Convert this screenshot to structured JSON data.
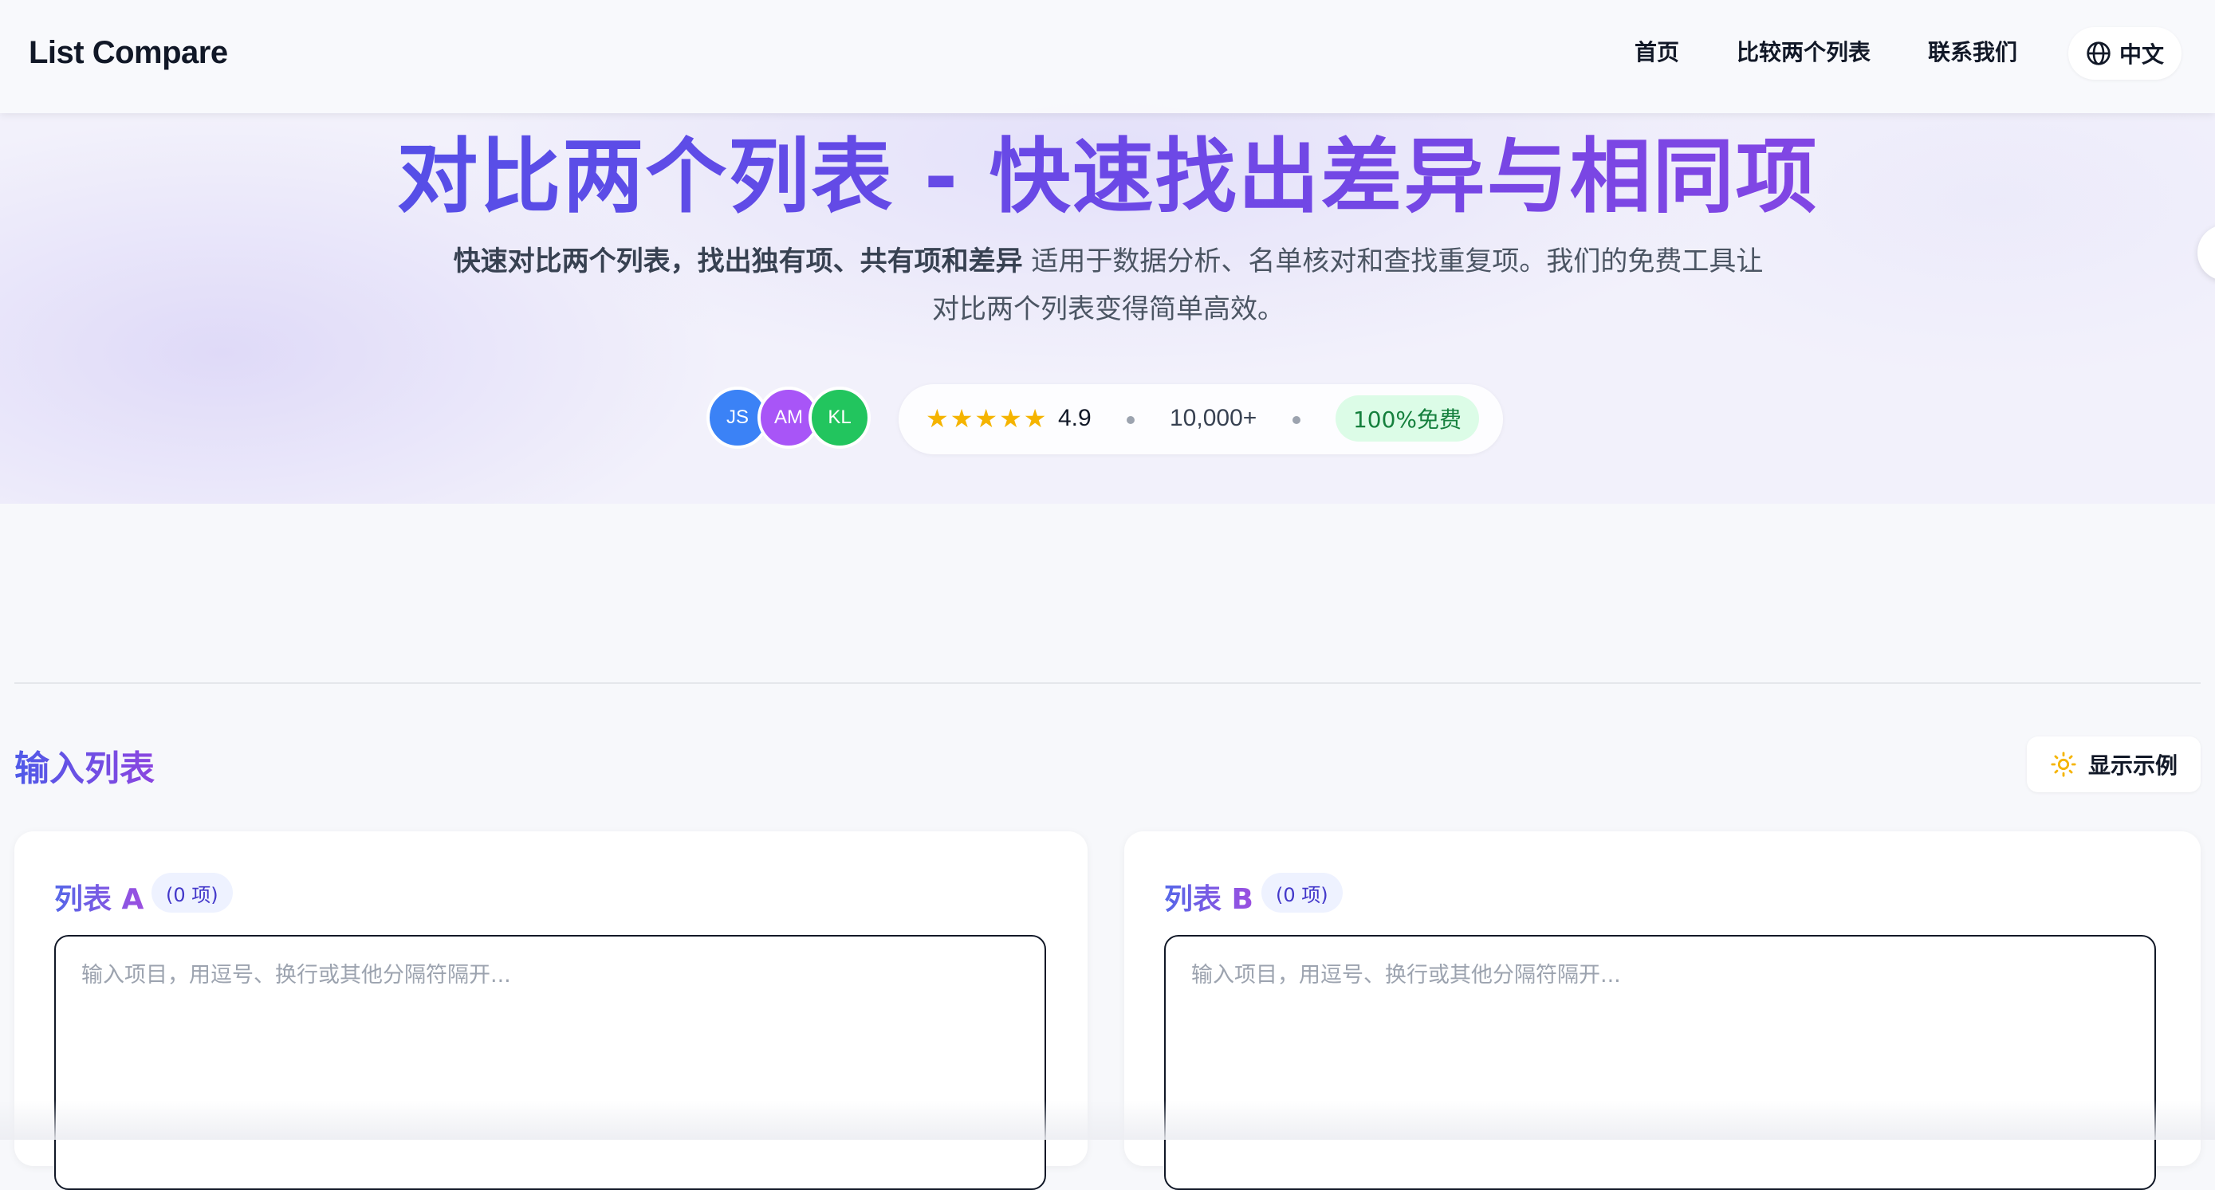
{
  "nav": {
    "brand": "List Compare",
    "links": [
      "首页",
      "比较两个列表",
      "联系我们"
    ],
    "language": "中文"
  },
  "hero": {
    "title": "对比两个列表 - 快速找出差异与相同项",
    "subtitle_bold": "快速对比两个列表，找出独有项、共有项和差异",
    "subtitle_rest": " 适用于数据分析、名单核对和查找重复项。我们的免费工具让对比两个列表变得简单高效。",
    "avatars": [
      {
        "initials": "JS",
        "color": "#3b82f6"
      },
      {
        "initials": "AM",
        "color": "#a855f7"
      },
      {
        "initials": "KL",
        "color": "#22c55e"
      }
    ],
    "rating_stars": 5,
    "rating": "4.9",
    "users": "10,000+",
    "free_badge": "100%免费"
  },
  "input_section": {
    "title": "输入列表",
    "example_button": "显示示例"
  },
  "lists": [
    {
      "title": "列表 A",
      "count": "(0 项)",
      "placeholder": "输入项目，用逗号、换行或其他分隔符隔开..."
    },
    {
      "title": "列表 B",
      "count": "(0 项)",
      "placeholder": "输入项目，用逗号、换行或其他分隔符隔开..."
    }
  ],
  "colors": {
    "accent_blue": "#4a52e8",
    "accent_purple": "#8e44e2",
    "star": "#f5b400",
    "free_badge_bg": "#dcfce7",
    "free_badge_text": "#15803d"
  }
}
